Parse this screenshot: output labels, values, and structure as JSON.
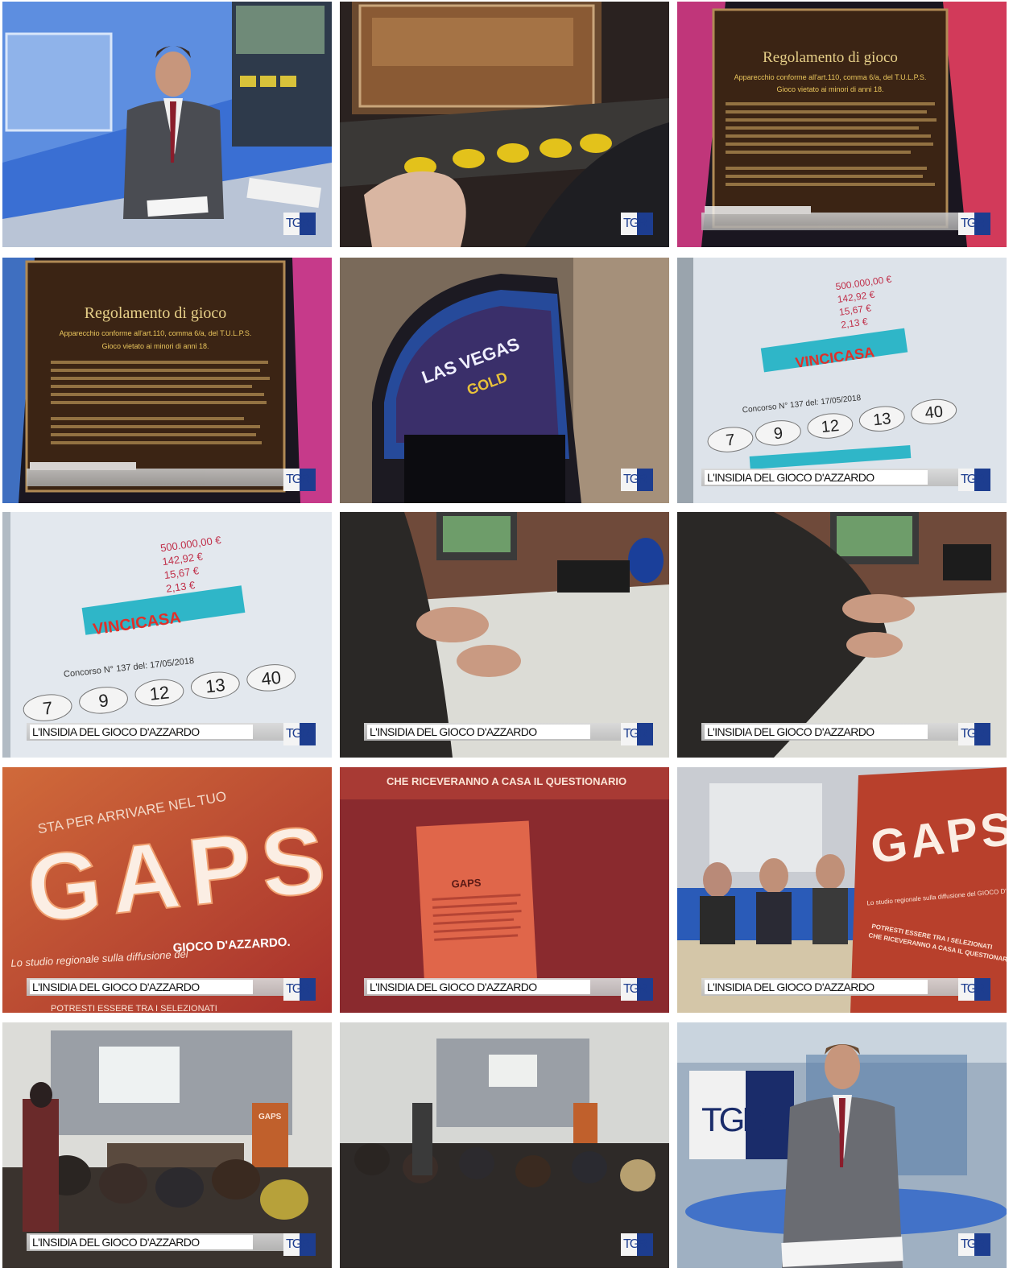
{
  "caption_label": "L'INSIDIA DEL GIOCO D'AZZARDO",
  "logo_text": "TGR",
  "frames": [
    {
      "id": "f1",
      "scene": "anchor-studio",
      "caption": ""
    },
    {
      "id": "f2",
      "scene": "slot-buttons",
      "caption": ""
    },
    {
      "id": "f3",
      "scene": "regolamento",
      "caption": "",
      "text": {
        "title": "Regolamento di gioco",
        "line1": "Apparecchio conforme all'art.110, comma 6/a, del T.U.L.P.S.",
        "line2": "Gioco vietato ai minori di anni 18."
      }
    },
    {
      "id": "f4",
      "scene": "regolamento",
      "caption": "",
      "text": {
        "title": "Regolamento di gioco",
        "line1": "Apparecchio conforme all'art.110, comma 6/a, del T.U.L.P.S.",
        "line2": "Gioco vietato ai minori di anni 18."
      }
    },
    {
      "id": "f5",
      "scene": "las-vegas",
      "caption": "",
      "text": {
        "sign": "LAS VEGAS",
        "sub": "GOLD"
      }
    },
    {
      "id": "f6",
      "scene": "vincicasa",
      "caption": "L'INSIDIA DEL GIOCO D'AZZARDO",
      "text": {
        "prize": "500.000,00 €",
        "p2": "142,92 €",
        "p3": "15,67 €",
        "p4": "2,13 €",
        "brand": "VINCICASA",
        "concorso": "Concorso N° 137 del: 17/05/2018",
        "numbers": [
          "7",
          "9",
          "12",
          "13",
          "40"
        ]
      }
    },
    {
      "id": "f7",
      "scene": "vincicasa",
      "caption": "L'INSIDIA DEL GIOCO D'AZZARDO",
      "text": {
        "prize": "500.000,00 €",
        "p2": "142,92 €",
        "p3": "15,67 €",
        "p4": "2,13 €",
        "brand": "VINCICASA",
        "concorso": "Concorso N° 137 del: 17/05/2018",
        "numbers": [
          "7",
          "9",
          "12",
          "13",
          "40"
        ]
      }
    },
    {
      "id": "f8",
      "scene": "hands-table",
      "caption": "L'INSIDIA DEL GIOCO D'AZZARDO"
    },
    {
      "id": "f9",
      "scene": "hands-table",
      "caption": "L'INSIDIA DEL GIOCO D'AZZARDO"
    },
    {
      "id": "f10",
      "scene": "gaps-banner",
      "caption": "L'INSIDIA DEL GIOCO D'AZZARDO",
      "text": {
        "top": "STA PER ARRIVARE NEL TUO",
        "big": "GAPS",
        "sub1": "Lo studio regionale sulla diffusione del",
        "sub2": "GIOCO D'AZZARDO.",
        "bottom": "POTRESTI ESSERE TRA I SELEZIONATI"
      }
    },
    {
      "id": "f11",
      "scene": "gaps-sheet",
      "caption": "L'INSIDIA DEL GIOCO D'AZZARDO",
      "text": {
        "top": "CHE RICEVERANNO A CASA IL QUESTIONARIO",
        "sheet": "GAPS"
      }
    },
    {
      "id": "f12",
      "scene": "panel-gaps",
      "caption": "L'INSIDIA DEL GIOCO D'AZZARDO",
      "text": {
        "big": "GAPS",
        "sub": "Lo studio regionale sulla diffusione del GIOCO D'AZZARDO",
        "l1": "POTRESTI ESSERE TRA I SELEZIONATI",
        "l2": "CHE RICEVERANNO A CASA IL QUESTIONARIO"
      }
    },
    {
      "id": "f13",
      "scene": "conference-room",
      "caption": "L'INSIDIA DEL GIOCO D'AZZARDO",
      "text": {
        "poster": "GAPS"
      }
    },
    {
      "id": "f14",
      "scene": "conference-wide",
      "caption": ""
    },
    {
      "id": "f15",
      "scene": "anchor-tgr",
      "caption": "",
      "text": {
        "wall": "TGR"
      }
    }
  ],
  "colors": {
    "tgr_blue": "#1d3d8f",
    "studio_blue": "#2a63c9",
    "gaps_red": "#b8402c"
  }
}
